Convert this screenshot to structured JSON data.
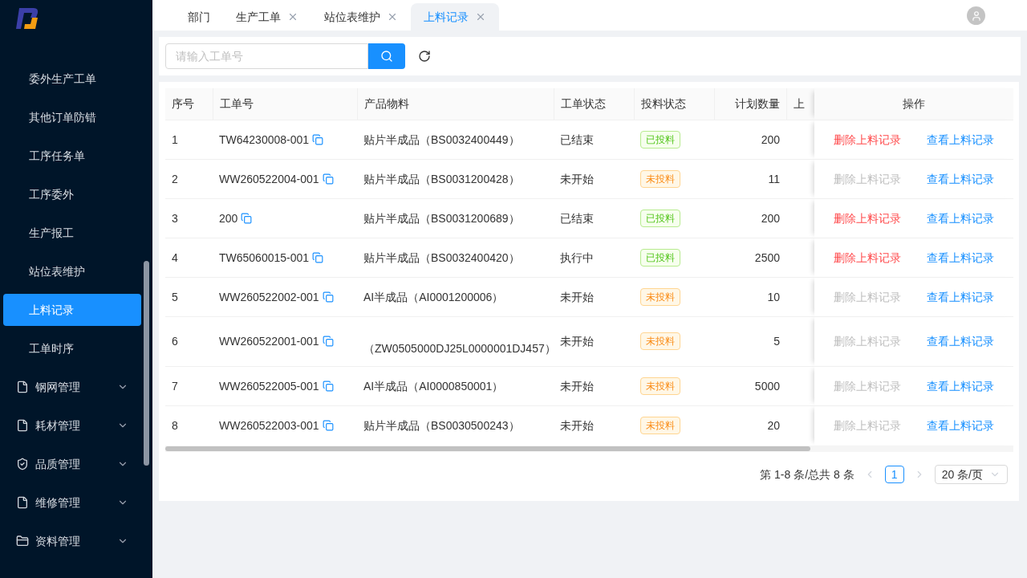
{
  "sidebar": {
    "items": [
      {
        "label": "委外生产工单",
        "kind": "sub",
        "selected": false
      },
      {
        "label": "其他订单防错",
        "kind": "sub",
        "selected": false
      },
      {
        "label": "工序任务单",
        "kind": "sub",
        "selected": false
      },
      {
        "label": "工序委外",
        "kind": "sub",
        "selected": false
      },
      {
        "label": "生产报工",
        "kind": "sub",
        "selected": false
      },
      {
        "label": "站位表维护",
        "kind": "sub",
        "selected": false
      },
      {
        "label": "上料记录",
        "kind": "sub",
        "selected": true
      },
      {
        "label": "工单时序",
        "kind": "sub",
        "selected": false
      },
      {
        "label": "钢网管理",
        "kind": "file",
        "selected": false,
        "expanded": false
      },
      {
        "label": "耗材管理",
        "kind": "file",
        "selected": false,
        "expanded": false
      },
      {
        "label": "品质管理",
        "kind": "shield",
        "selected": false,
        "expanded": false
      },
      {
        "label": "维修管理",
        "kind": "file",
        "selected": false,
        "expanded": false
      },
      {
        "label": "资料管理",
        "kind": "folder",
        "selected": false,
        "expanded": false
      }
    ]
  },
  "tabs": [
    {
      "label": "部门",
      "closable": false,
      "selected": false
    },
    {
      "label": "生产工单",
      "closable": true,
      "selected": false
    },
    {
      "label": "站位表维护",
      "closable": true,
      "selected": false
    },
    {
      "label": "上料记录",
      "closable": true,
      "selected": true
    }
  ],
  "search": {
    "placeholder": "请输入工单号"
  },
  "table": {
    "columns": [
      "序号",
      "工单号",
      "产品物料",
      "工单状态",
      "投料状态",
      "计划数量",
      "上",
      "操作"
    ],
    "rows": [
      {
        "index": "1",
        "order": "TW64230008-001",
        "material": "贴片半成品（BS0032400449）",
        "status": "已结束",
        "feed": {
          "label": "已投料",
          "kind": "fed"
        },
        "qty": "200",
        "delete": {
          "label": "删除上料记录",
          "disabled": false
        },
        "view": "查看上料记录",
        "tall": false
      },
      {
        "index": "2",
        "order": "WW260522004-001",
        "material": "贴片半成品（BS0031200428）",
        "status": "未开始",
        "feed": {
          "label": "未投料",
          "kind": "pending"
        },
        "qty": "11",
        "delete": {
          "label": "删除上料记录",
          "disabled": true
        },
        "view": "查看上料记录",
        "tall": false
      },
      {
        "index": "3",
        "order": "200",
        "material": "贴片半成品（BS0031200689）",
        "status": "已结束",
        "feed": {
          "label": "已投料",
          "kind": "fed"
        },
        "qty": "200",
        "delete": {
          "label": "删除上料记录",
          "disabled": false
        },
        "view": "查看上料记录",
        "tall": false
      },
      {
        "index": "4",
        "order": "TW65060015-001",
        "material": "贴片半成品（BS0032400420）",
        "status": "执行中",
        "feed": {
          "label": "已投料",
          "kind": "fed"
        },
        "qty": "2500",
        "delete": {
          "label": "删除上料记录",
          "disabled": false
        },
        "view": "查看上料记录",
        "tall": false
      },
      {
        "index": "5",
        "order": "WW260522002-001",
        "material": "AI半成品（AI0001200006）",
        "status": "未开始",
        "feed": {
          "label": "未投料",
          "kind": "pending"
        },
        "qty": "10",
        "delete": {
          "label": "删除上料记录",
          "disabled": true
        },
        "view": "查看上料记录",
        "tall": false
      },
      {
        "index": "6",
        "order": "WW260522001-001",
        "material": "（ZW0505000DJ25L0000001DJ457）",
        "status": "未开始",
        "feed": {
          "label": "未投料",
          "kind": "pending"
        },
        "qty": "5",
        "delete": {
          "label": "删除上料记录",
          "disabled": true
        },
        "view": "查看上料记录",
        "tall": true
      },
      {
        "index": "7",
        "order": "WW260522005-001",
        "material": "AI半成品（AI0000850001）",
        "status": "未开始",
        "feed": {
          "label": "未投料",
          "kind": "pending"
        },
        "qty": "5000",
        "delete": {
          "label": "删除上料记录",
          "disabled": true
        },
        "view": "查看上料记录",
        "tall": false
      },
      {
        "index": "8",
        "order": "WW260522003-001",
        "material": "贴片半成品（BS0030500243）",
        "status": "未开始",
        "feed": {
          "label": "未投料",
          "kind": "pending"
        },
        "qty": "20",
        "delete": {
          "label": "删除上料记录",
          "disabled": true
        },
        "view": "查看上料记录",
        "tall": false
      }
    ]
  },
  "pagination": {
    "summary": "第 1-8 条/总共 8 条",
    "pages": [
      {
        "label": "1",
        "selected": true
      }
    ],
    "page_size": "20 条/页"
  }
}
